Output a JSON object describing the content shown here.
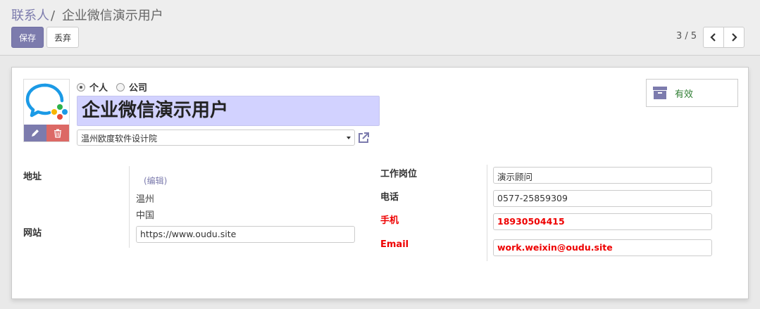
{
  "breadcrumb": {
    "parent": "联系人",
    "separator": "/",
    "current": "企业微信演示用户"
  },
  "toolbar": {
    "save_label": "保存",
    "discard_label": "丢弃"
  },
  "pager": {
    "value": "3 / 5",
    "prev_icon": "chevron-left-icon",
    "next_icon": "chevron-right-icon"
  },
  "form": {
    "company_type": {
      "options": [
        "个人",
        "公司"
      ],
      "selected": "个人"
    },
    "name": "企业微信演示用户",
    "parent_company": "温州欧度软件设计院",
    "status_button": {
      "label": "有效",
      "icon": "archive-icon"
    },
    "address": {
      "label": "地址",
      "edit_link": "(编辑)",
      "city": "温州",
      "country": "中国"
    },
    "website": {
      "label": "网站",
      "value": "https://www.oudu.site"
    },
    "job_position": {
      "label": "工作岗位",
      "value": "演示顾问"
    },
    "phone": {
      "label": "电话",
      "value": "0577-25859309"
    },
    "mobile": {
      "label": "手机",
      "value": "18930504415"
    },
    "email": {
      "label": "Email",
      "value": "work.weixin@oudu.site"
    }
  },
  "colors": {
    "primary": "#7c7bad",
    "danger": "#dc6965",
    "required": "#e00000",
    "status_green": "#2e7d32",
    "name_bg": "#d2d2ff"
  }
}
